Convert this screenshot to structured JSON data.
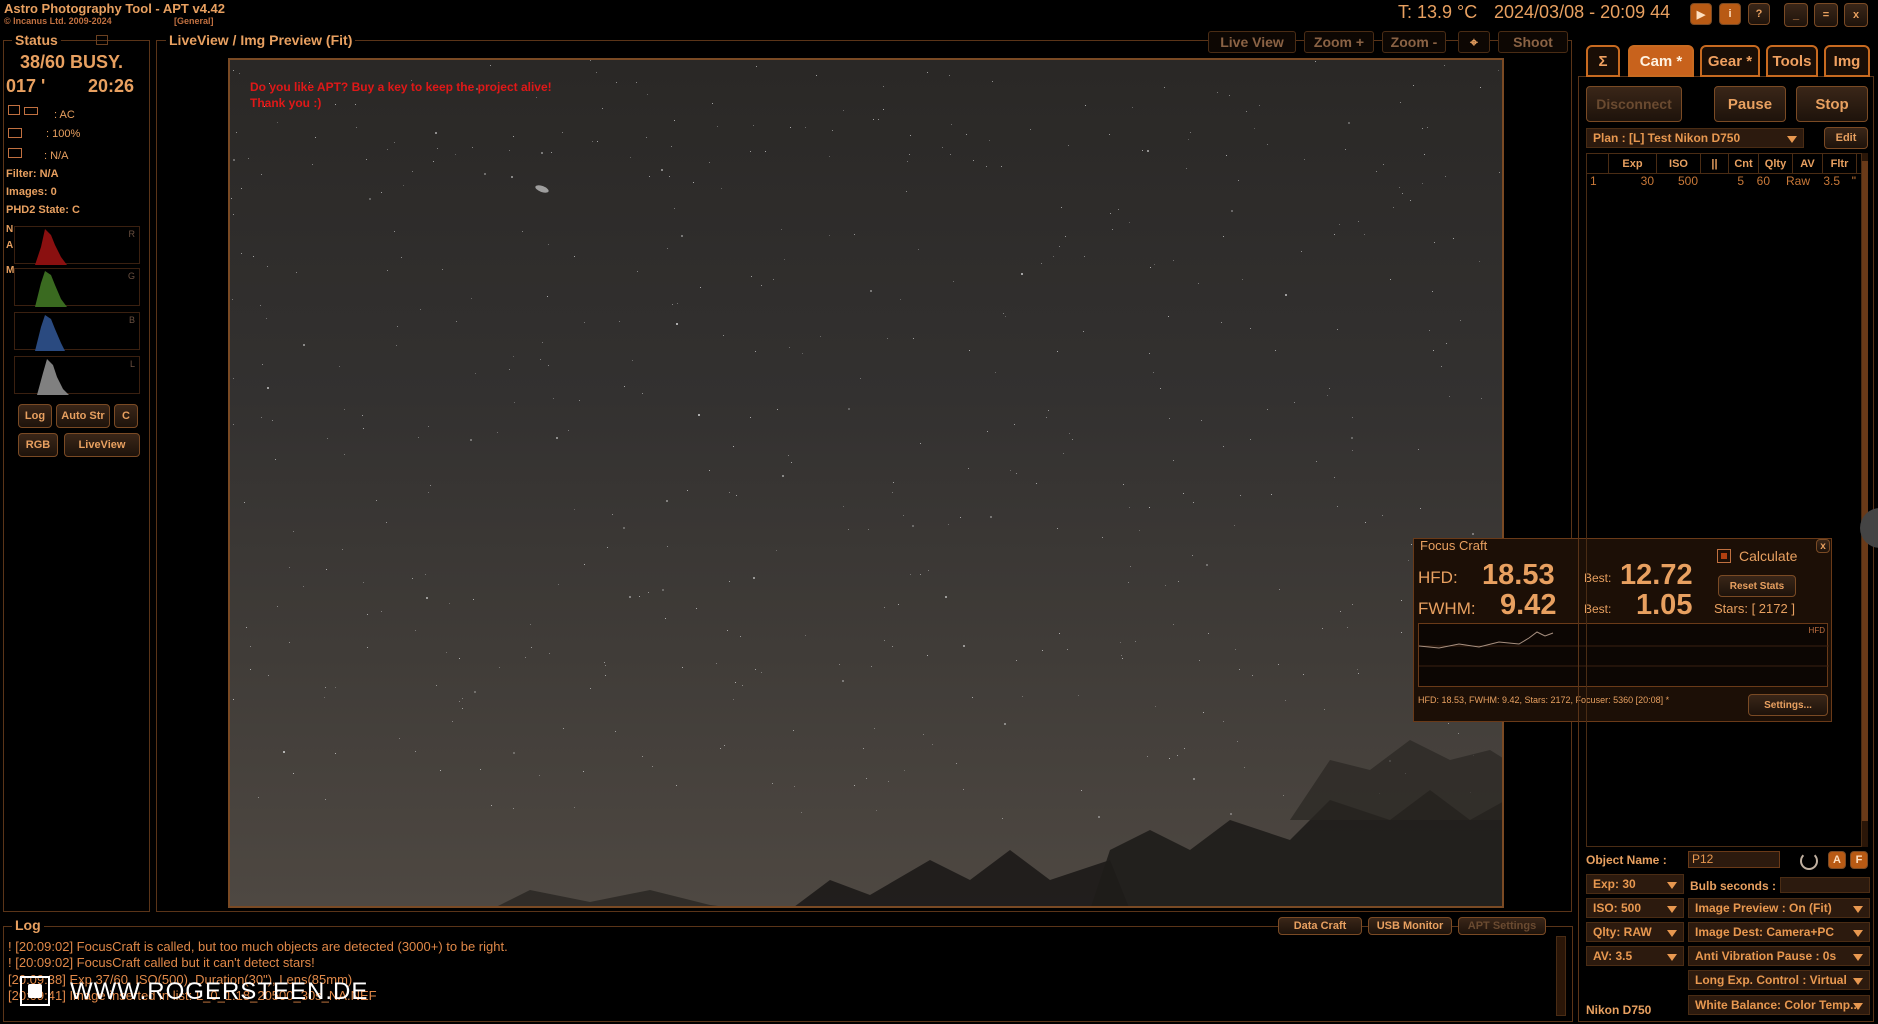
{
  "app": {
    "title": "Astro Photography Tool  -  APT v4.42",
    "copyright": "© Incanus Ltd. 2009-2024",
    "profile": "[General]"
  },
  "header": {
    "temperature": "T: 13.9 °C",
    "datetime": "2024/03/08 - 20:09 44"
  },
  "status": {
    "heading": "Status",
    "busy": "38/60 BUSY.",
    "left_time": "017 '",
    "right_time": "20:26",
    "power": ": AC",
    "battery": ": 100%",
    "other": ": N/A",
    "filter": "Filter: N/A",
    "images": "Images: 0",
    "phd2": "PHD2 State: C",
    "side_letters": [
      "N",
      "A",
      "M"
    ],
    "hist_labels": [
      "R",
      "G",
      "B",
      "L"
    ],
    "buttons": {
      "log": "Log",
      "autostr": "Auto Str",
      "c": "C",
      "rgb": "RGB",
      "liveview": "LiveView"
    }
  },
  "preview": {
    "heading": "LiveView / Img Preview (Fit)",
    "toolbar": {
      "liveview": "Live View",
      "zoomin": "Zoom +",
      "zoomout": "Zoom -",
      "shoot": "Shoot"
    },
    "nag_line1": "Do you like APT? Buy a key to keep the project alive!",
    "nag_line2": "Thank you :)"
  },
  "focus": {
    "title": "Focus Craft",
    "calculate": "Calculate",
    "hfd_label": "HFD:",
    "hfd": "18.53",
    "best_label": "Best:",
    "hfd_best": "12.72",
    "fwhm_label": "FWHM:",
    "fwhm": "9.42",
    "fwhm_best": "1.05",
    "stars": "Stars: [ 2172 ]",
    "reset": "Reset Stats",
    "graph_label": "HFD",
    "status": "HFD: 18.53, FWHM: 9.42, Stars: 2172, Focuser: 5360 [20:08] *",
    "settings": "Settings...",
    "close": "x"
  },
  "right": {
    "tabs": [
      "Σ",
      "Cam *",
      "Gear *",
      "Tools",
      "Img"
    ],
    "disconnect": "Disconnect",
    "pause": "Pause",
    "stop": "Stop",
    "plan": "Plan : [L] Test Nikon D750",
    "edit": "Edit",
    "plan_headers": [
      "",
      "Exp",
      "ISO",
      "||",
      "Cnt",
      "Qlty",
      "AV",
      "Fltr"
    ],
    "plan_row": [
      "1",
      "30",
      "500",
      "5",
      "60",
      "Raw",
      "3.5",
      "\""
    ],
    "object_label": "Object Name :",
    "object_value": "P12",
    "exp": "Exp: 30",
    "bulb": "Bulb seconds :",
    "iso": "ISO: 500",
    "img_preview": "Image Preview : On (Fit)",
    "qlty": "Qlty: RAW",
    "img_dest": "Image Dest: Camera+PC",
    "av": "AV: 3.5",
    "anti_vib": "Anti Vibration Pause : 0s",
    "long_exp": "Long Exp. Control : Virtual",
    "wb": "White Balance: Color Temp...",
    "camera": "Nikon D750",
    "btn_a": "A",
    "btn_f": "F"
  },
  "log": {
    "heading": "Log",
    "buttons": {
      "datacraft": "Data Craft",
      "usb": "USB Monitor",
      "apt": "APT Settings"
    },
    "lines": [
      "! [20:09:02] FocusCraft is called, but too much objects are detected (3000+) to be right.",
      "! [20:09:02] FocusCraft called but it can't detect stars!",
      "  [20:09:38] Exp 37/60, ISO(500), Duration(30\"), Lens(85mm)",
      "  [20:09:41] Image inserted in list: L_0_1:18_20500_30s_NA.NEF"
    ]
  },
  "watermark": "WWW.ROGERSTEEN.DE"
}
